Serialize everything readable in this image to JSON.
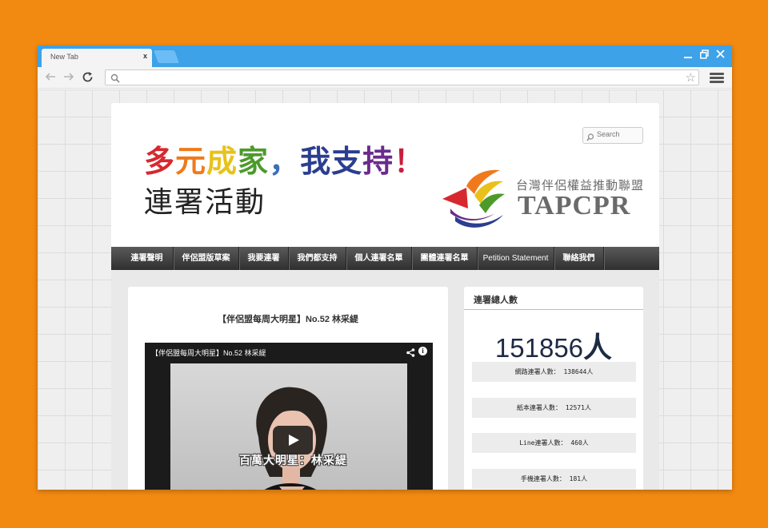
{
  "browser": {
    "tab_title": "New Tab",
    "tab_close": "x",
    "omnibox_value": ""
  },
  "site": {
    "slogan_parts": [
      {
        "text": "多",
        "color": "#d7282f"
      },
      {
        "text": "元",
        "color": "#f07a1b"
      },
      {
        "text": "成",
        "color": "#e8c21a"
      },
      {
        "text": "家",
        "color": "#4c9a2a"
      },
      {
        "text": "，",
        "color": "#3b6fb6"
      },
      {
        "text": "我",
        "color": "#2b3e8f"
      },
      {
        "text": "支",
        "color": "#2b3e8f"
      },
      {
        "text": "持",
        "color": "#6a2b8a"
      },
      {
        "text": "！",
        "color": "#c81e3c"
      }
    ],
    "subtitle": "連署活動",
    "search_placeholder": "Search",
    "logo_chinese": "台灣伴侶權益推動聯盟",
    "logo_english": "TAPCPR"
  },
  "nav": {
    "items": [
      "連署聲明",
      "伴侶盟版草案",
      "我要連署",
      "我們都支持",
      "個人連署名單",
      "團體連署名單",
      "Petition Statement",
      "聯絡我們"
    ]
  },
  "post": {
    "title": "【伴侶盟每周大明星】No.52 林采緹",
    "video_title": "【伴侶盟每周大明星】No.52 林采緹",
    "caption": "百萬大明星：林采緹",
    "info": "i"
  },
  "sidebar": {
    "heading": "連署總人數",
    "total_number": "151856",
    "total_unit": "人",
    "stats": [
      "網路連署人數： 138644人",
      "紙本連署人數： 12571人",
      "Line連署人數： 460人",
      "手機連署人數： 181人"
    ]
  }
}
